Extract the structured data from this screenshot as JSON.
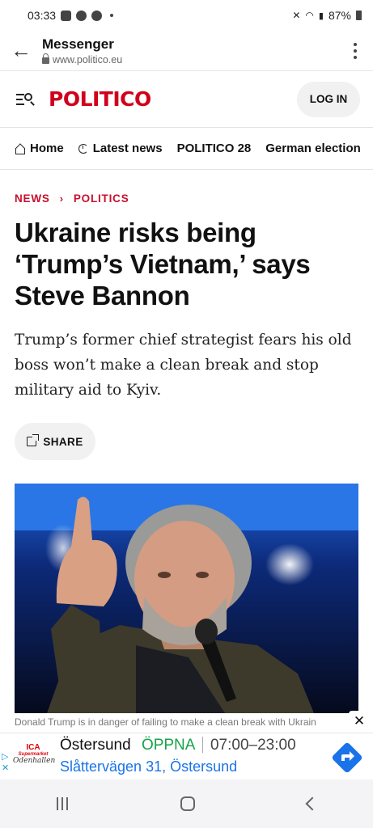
{
  "status_bar": {
    "time": "03:33",
    "battery": "87%"
  },
  "browser": {
    "title": "Messenger",
    "url": "www.politico.eu"
  },
  "site": {
    "logo": "POLITICO",
    "login_label": "LOG IN"
  },
  "nav": {
    "items": [
      "Home",
      "Latest news",
      "POLITICO 28",
      "German election"
    ]
  },
  "breadcrumb": {
    "section": "NEWS",
    "subsection": "POLITICS",
    "separator": "›"
  },
  "article": {
    "headline": "Ukraine risks being ‘Trump’s Vietnam,’ says Steve Bannon",
    "dek": "Trump’s former chief strategist fears his old boss won’t make a clean break and stop military aid to Kyiv.",
    "share_label": "SHARE",
    "caption": "Donald Trump is in danger of failing to make a clean break with Ukrain"
  },
  "ad": {
    "brand": "ICA",
    "brand_sub": "Supermarket",
    "brand_script": "Odenhallen",
    "place": "Östersund",
    "status": "ÖPPNA",
    "hours": "07:00–23:00",
    "address": "Slåttervägen 31, Östersund",
    "close": "✕"
  },
  "colors": {
    "brand_red": "#d0021b",
    "crumb_red": "#c8102e",
    "open_green": "#16a34a",
    "link_blue": "#1a73e8"
  }
}
